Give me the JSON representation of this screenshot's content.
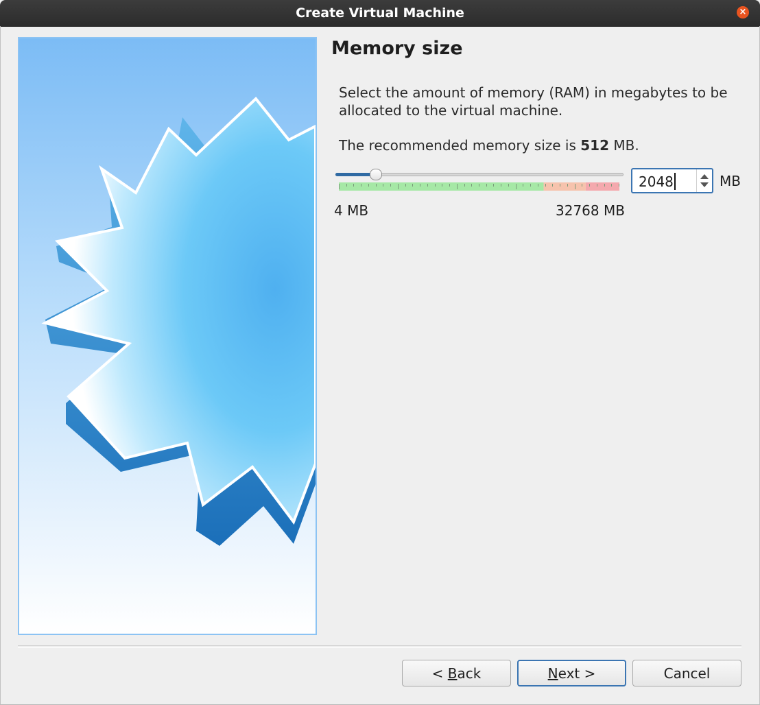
{
  "window": {
    "title": "Create Virtual Machine",
    "close_glyph": "×"
  },
  "page": {
    "title": "Memory size",
    "description": "Select the amount of memory (RAM) in megabytes to be allocated to the virtual machine.",
    "recommend_prefix": "The recommended memory size is ",
    "recommend_value": "512",
    "recommend_suffix": " MB."
  },
  "memory": {
    "value": "2048",
    "unit": "MB",
    "min_label": "4 MB",
    "max_label": "32768 MB",
    "slider_min": 4,
    "slider_max": 32768,
    "slider_value": 2048,
    "zones": {
      "green_end_fraction": 0.73,
      "orange_end_fraction": 0.88
    },
    "colors": {
      "safe": "#a6e8a6",
      "warn": "#f6c3ad",
      "danger": "#f4a9ae"
    }
  },
  "buttons": {
    "back_mnemonic_prefix": "< ",
    "back_mnemonic": "B",
    "back_rest": "ack",
    "next_mnemonic": "N",
    "next_rest": "ext >",
    "cancel": "Cancel"
  },
  "icons": {
    "close": "close-icon",
    "wizard_art": "virtualbox-star-image"
  }
}
